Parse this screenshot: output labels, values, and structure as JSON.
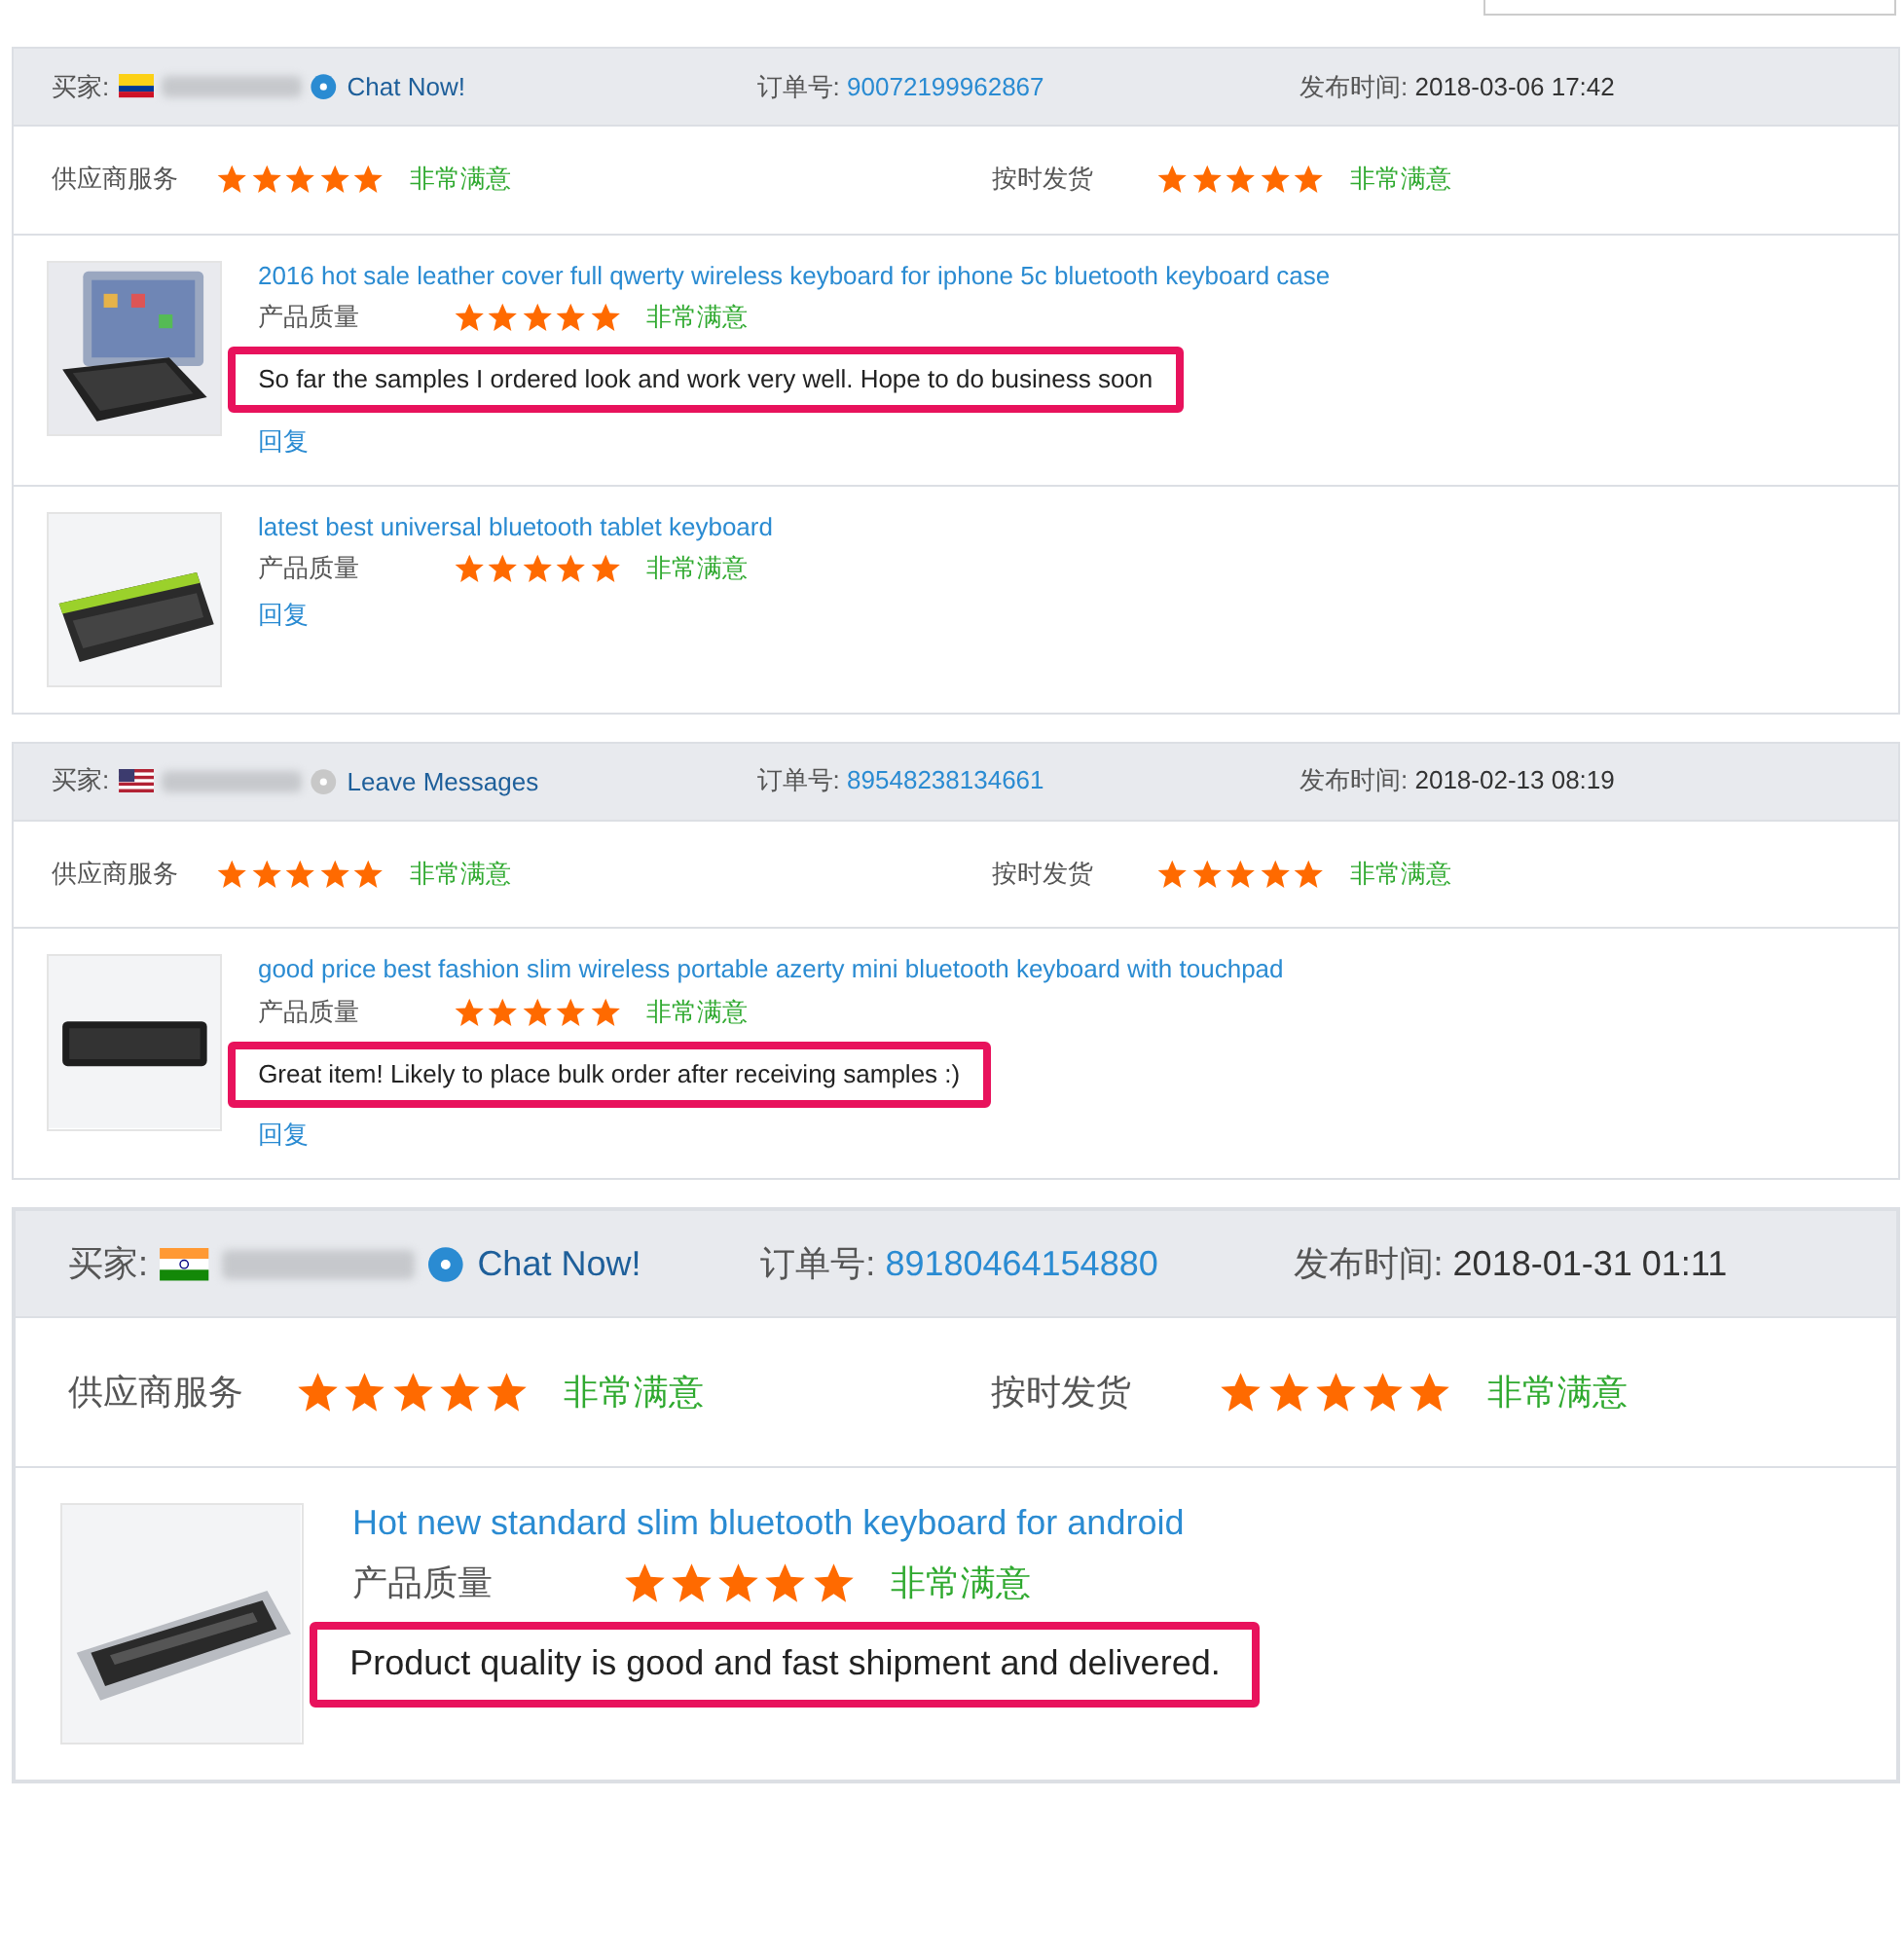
{
  "reviews": [
    {
      "buyer_label": "买家:",
      "contact": {
        "label": "Chat Now!",
        "online": true
      },
      "order_label": "订单号:",
      "order_no": "90072199962867",
      "time_label": "发布时间:",
      "time": "2018-03-06 17:42",
      "ratings": [
        {
          "label": "供应商服务",
          "stars": 5,
          "verdict": "非常满意"
        },
        {
          "label": "按时发货",
          "stars": 5,
          "verdict": "非常满意"
        }
      ],
      "products": [
        {
          "title": "2016 hot sale leather cover full qwerty wireless keyboard for iphone 5c bluetooth keyboard case",
          "quality_label": "产品质量",
          "stars": 5,
          "verdict": "非常满意",
          "comment": "So far the samples I ordered look and work very well. Hope to do business soon",
          "reply": "回复"
        },
        {
          "title": "latest best universal bluetooth tablet keyboard",
          "quality_label": "产品质量",
          "stars": 5,
          "verdict": "非常满意",
          "reply": "回复"
        }
      ]
    },
    {
      "buyer_label": "买家:",
      "contact": {
        "label": "Leave Messages",
        "online": false
      },
      "order_label": "订单号:",
      "order_no": "89548238134661",
      "time_label": "发布时间:",
      "time": "2018-02-13 08:19",
      "ratings": [
        {
          "label": "供应商服务",
          "stars": 5,
          "verdict": "非常满意"
        },
        {
          "label": "按时发货",
          "stars": 5,
          "verdict": "非常满意"
        }
      ],
      "products": [
        {
          "title": "good price best fashion slim wireless portable azerty mini bluetooth keyboard with touchpad",
          "quality_label": "产品质量",
          "stars": 5,
          "verdict": "非常满意",
          "comment": "Great item! Likely to place bulk order after receiving samples :)",
          "reply": "回复"
        }
      ]
    },
    {
      "buyer_label": "买家:",
      "contact": {
        "label": "Chat Now!",
        "online": true
      },
      "order_label": "订单号:",
      "order_no": "89180464154880",
      "time_label": "发布时间:",
      "time": "2018-01-31 01:11",
      "ratings": [
        {
          "label": "供应商服务",
          "stars": 5,
          "verdict": "非常满意"
        },
        {
          "label": "按时发货",
          "stars": 5,
          "verdict": "非常满意"
        }
      ],
      "products": [
        {
          "title": "Hot new standard slim bluetooth keyboard for android",
          "quality_label": "产品质量",
          "stars": 5,
          "verdict": "非常满意",
          "comment": "Product quality is good and fast shipment and delivered."
        }
      ]
    }
  ]
}
